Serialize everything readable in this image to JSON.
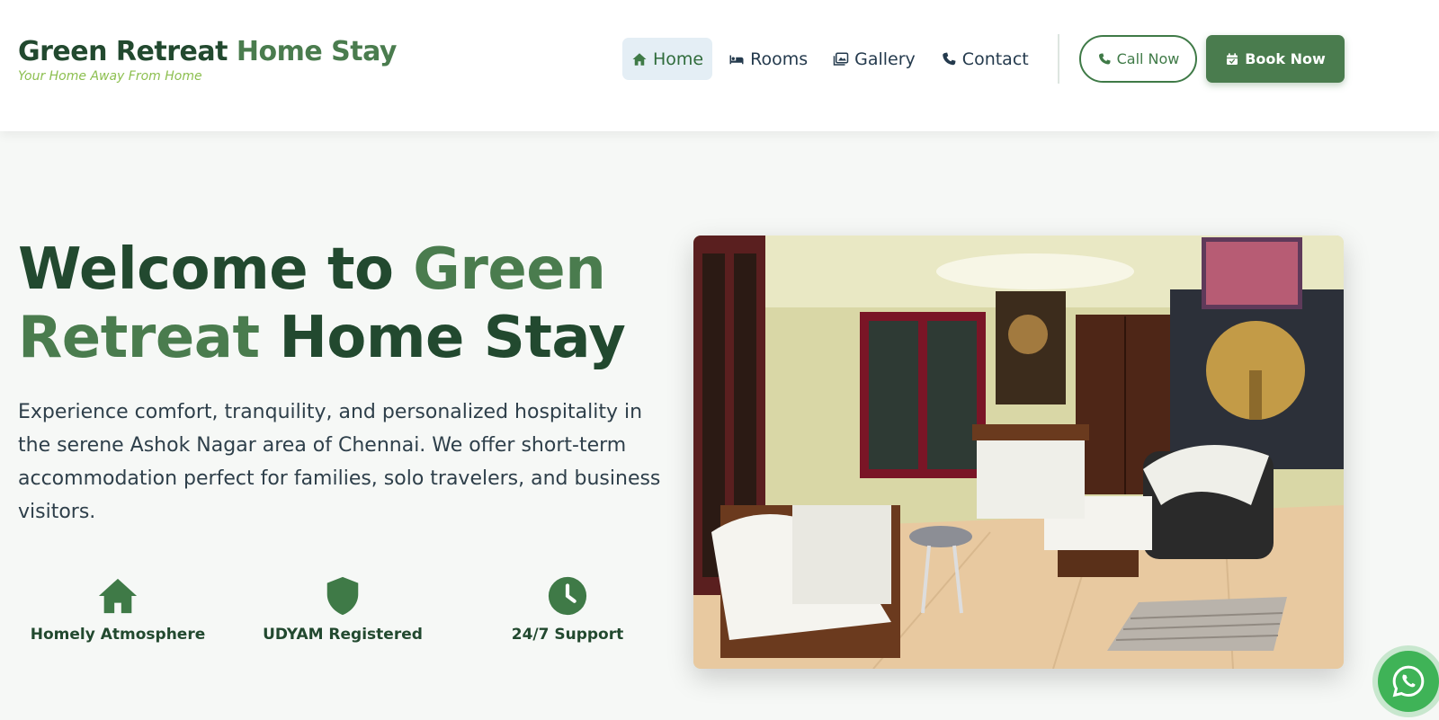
{
  "brand": {
    "name_part1": "Green Retreat",
    "name_part2": "Home Stay",
    "tagline": "Your Home Away From Home"
  },
  "nav": {
    "items": [
      {
        "label": "Home",
        "icon": "home-icon",
        "active": true
      },
      {
        "label": "Rooms",
        "icon": "bed-icon",
        "active": false
      },
      {
        "label": "Gallery",
        "icon": "images-icon",
        "active": false
      },
      {
        "label": "Contact",
        "icon": "phone-icon",
        "active": false
      }
    ]
  },
  "actions": {
    "call_label": "Call Now",
    "book_label": "Book Now"
  },
  "hero": {
    "title_1": "Welcome to ",
    "title_2": "Green",
    "title_3": "Retreat",
    "title_4": " Home Stay",
    "description": "Experience comfort, tranquility, and personalized hospitality in the serene Ashok Nagar area of Chennai. We offer short-term accommodation perfect for families, solo travelers, and business visitors."
  },
  "features": [
    {
      "label": "Homely Atmosphere",
      "icon": "home-icon"
    },
    {
      "label": "UDYAM Registered",
      "icon": "shield-icon"
    },
    {
      "label": "24/7 Support",
      "icon": "clock-icon"
    }
  ],
  "colors": {
    "primary": "#4a7c4e",
    "dark_green": "#22492f",
    "accent_light": "#8cbf4f",
    "whatsapp": "#3fb357"
  }
}
